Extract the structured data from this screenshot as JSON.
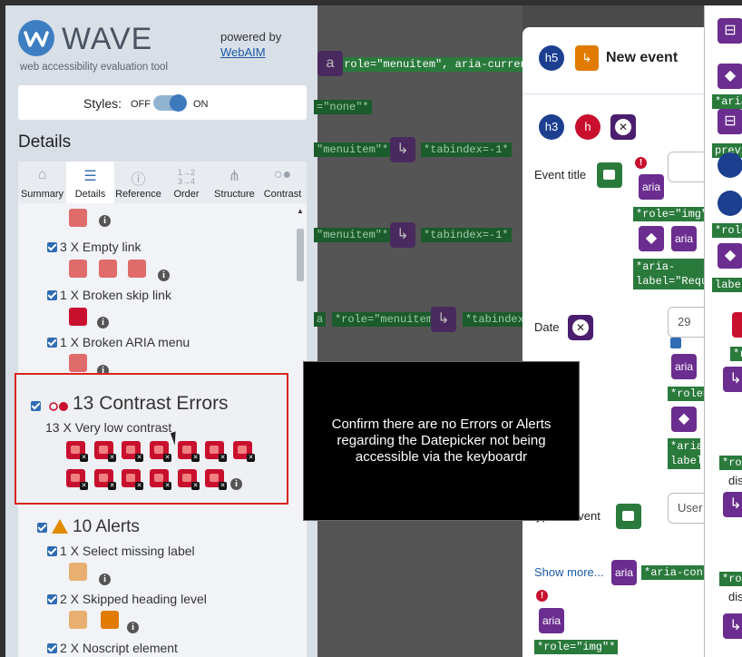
{
  "wave": {
    "logo_word": "WAVE",
    "logo_tag": "web accessibility evaluation tool",
    "powered_by": "powered by",
    "webaim": "WebAIM",
    "styles_label": "Styles:",
    "off": "OFF",
    "on": "ON",
    "details_heading": "Details",
    "tabs": [
      {
        "label": "Summary",
        "icon": "home-icon"
      },
      {
        "label": "Details",
        "icon": "list-icon"
      },
      {
        "label": "Reference",
        "icon": "info-icon"
      },
      {
        "label": "Order",
        "icon": "order-icon"
      },
      {
        "label": "Structure",
        "icon": "structure-icon"
      },
      {
        "label": "Contrast",
        "icon": "contrast-icon"
      }
    ],
    "items": [
      {
        "label": "3 X Empty link"
      },
      {
        "label": "1 X Broken skip link"
      },
      {
        "label": "1 X Broken ARIA menu"
      }
    ],
    "contrast": {
      "title": "13 Contrast Errors",
      "sub": "13 X Very low contrast"
    },
    "alerts": {
      "title": "10 Alerts"
    },
    "alert_items": [
      {
        "label": "1 X Select missing label"
      },
      {
        "label": "2 X Skipped heading level"
      },
      {
        "label": "2 X Noscript element"
      }
    ]
  },
  "page": {
    "tags": [
      "*role=\"menuitem\", aria-current=\"true\"",
      "=\"none\"*",
      "\"menuitem\"*",
      "*tabindex=-1*",
      "\"menuitem\"*",
      "*tabindex=-1*",
      "a",
      "*role=\"menuitem\"*",
      "*tabindex=-",
      "*aria-contro"
    ]
  },
  "dialog": {
    "h5": "h5",
    "title": "New event",
    "h3": "h3",
    "event_title_label": "Event title",
    "aria": "aria",
    "role_img": "*role=\"img\"*",
    "aria_label_tag": "*aria-label=\"Require",
    "date_label": "Date",
    "date_value": "29",
    "role_trunc": "*role=\"",
    "aria_label_trunc": "*aria-label",
    "type_label": "ype of event",
    "user_placeholder": "User",
    "show_more": "Show more...",
    "aria_controls": "*aria-contro",
    "role_img_bottom": "*role=\"img\"*"
  },
  "tooltip": {
    "text": "Confirm there are no Errors or Alerts regarding the Datepicker not being accessible via the keyboardr"
  },
  "right_panel": {
    "tags": [
      "*aria-",
      "previ",
      "*role=",
      "label=",
      "*rol",
      "*role",
      "dis",
      "*role",
      "dis"
    ]
  }
}
